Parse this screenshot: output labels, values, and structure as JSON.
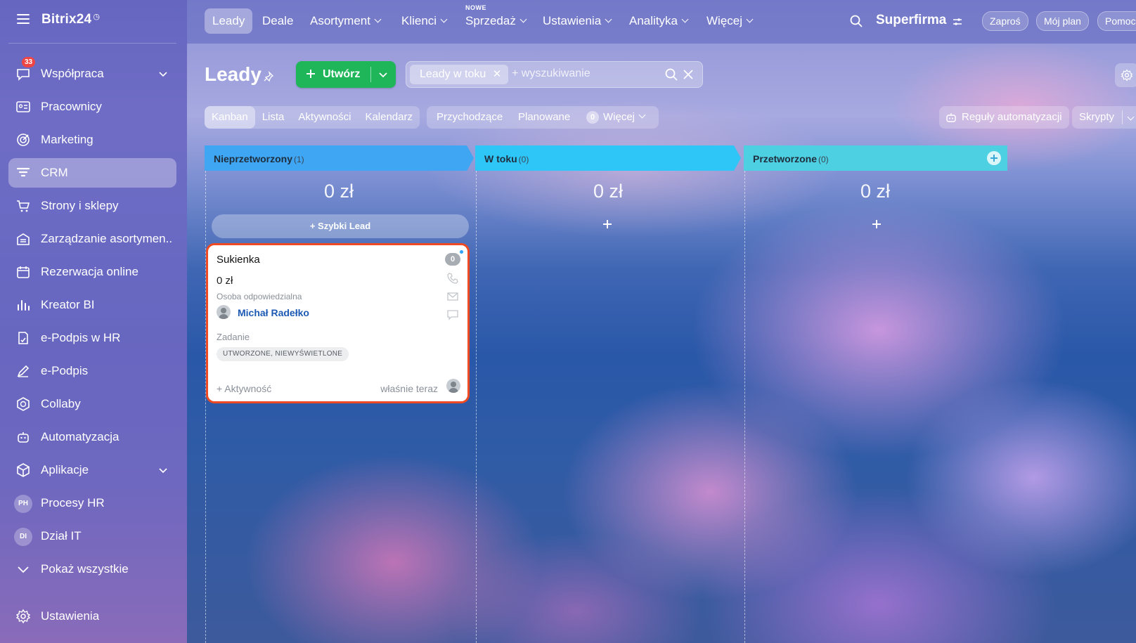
{
  "sidebar": {
    "logo": "Bitrix24",
    "items": [
      {
        "label": "Współpraca",
        "badge": "33",
        "chevron": true
      },
      {
        "label": "Pracownicy"
      },
      {
        "label": "Marketing"
      },
      {
        "label": "CRM",
        "active": true
      },
      {
        "label": "Strony i sklepy"
      },
      {
        "label": "Zarządzanie asortymen..."
      },
      {
        "label": "Rezerwacja online"
      },
      {
        "label": "Kreator BI"
      },
      {
        "label": "e-Podpis w HR"
      },
      {
        "label": "e-Podpis"
      },
      {
        "label": "Collaby"
      },
      {
        "label": "Automatyzacja"
      },
      {
        "label": "Aplikacje",
        "chevron": true
      },
      {
        "label": "Procesy HR",
        "initials": "PH"
      },
      {
        "label": "Dział IT",
        "initials": "DI"
      },
      {
        "label": "Pokaż wszystkie"
      }
    ],
    "settings_label": "Ustawienia"
  },
  "topnav": {
    "tabs": [
      {
        "label": "Leady",
        "active": true
      },
      {
        "label": "Deale"
      },
      {
        "label": "Asortyment"
      },
      {
        "label": "Klienci"
      },
      {
        "label": "Sprzedaż"
      },
      {
        "label": "Ustawienia"
      },
      {
        "label": "Analityka"
      },
      {
        "label": "Więcej"
      }
    ],
    "new_badge": "NOWE",
    "brand": "Superfirma",
    "invite": "Zaproś",
    "my_plan": "Mój plan",
    "help": "Pomoc"
  },
  "header": {
    "title": "Leady",
    "create_label": "Utwórz",
    "filter_chip": "Leady w toku",
    "search_placeholder": "+ wyszukiwanie"
  },
  "views": {
    "tabs": [
      "Kanban",
      "Lista",
      "Aktywności",
      "Kalendarz"
    ],
    "counters": [
      "Przychodzące",
      "Planowane"
    ],
    "counter_badge": "0",
    "more": "Więcej",
    "rules": "Reguły automatyzacji",
    "scripts": "Skrypty"
  },
  "kanban": {
    "columns": [
      {
        "title": "Nieprzetworzony",
        "count": "(1)",
        "sum": "0 zł",
        "color": "#3ea6f2"
      },
      {
        "title": "W toku",
        "count": "(0)",
        "sum": "0 zł",
        "color": "#2ec6f7"
      },
      {
        "title": "Przetworzone",
        "count": "(0)",
        "sum": "0 zł",
        "color": "#4dd0e1"
      }
    ],
    "quick_lead": "+ Szybki Lead",
    "card": {
      "title": "Sukienka",
      "badge": "0",
      "amount": "0 zł",
      "responsible_label": "Osoba odpowiedzialna",
      "responsible": "Michał Radełko",
      "task_label": "Zadanie",
      "status": "UTWORZONE, NIEWYŚWIETLONE",
      "activity": "+ Aktywność",
      "time": "właśnie teraz"
    }
  },
  "colors": {
    "accent_green": "#1fb65a",
    "card_border": "#ee4a24",
    "link_blue": "#1c5ab3"
  }
}
